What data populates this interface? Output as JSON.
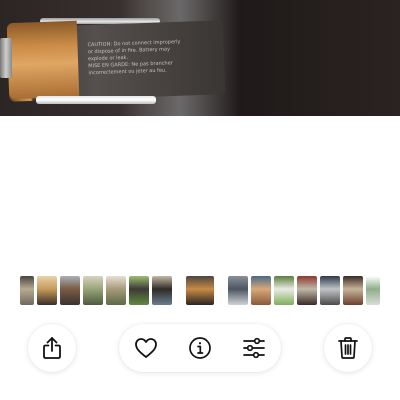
{
  "photo": {
    "subject": "battery-photo",
    "label_text_line1": "CAUTION: Do not connect improperly",
    "label_text_line2": "or dispose of in fire. Battery may",
    "label_text_line3": "explode or leak.",
    "label_text_line4": "MISE EN GARDE: Ne pas brancher",
    "label_text_line5": "incorrectement ou jeter au feu."
  },
  "thumbnails": [
    {
      "name": "thumb-1",
      "colors": [
        "#6f6a5f",
        "#b8aa90",
        "#4a4540"
      ]
    },
    {
      "name": "thumb-2",
      "colors": [
        "#3a2f27",
        "#c79a5a",
        "#e7d2a8"
      ]
    },
    {
      "name": "thumb-3",
      "colors": [
        "#3b3330",
        "#7a5a45",
        "#a8b0b8"
      ]
    },
    {
      "name": "thumb-4",
      "colors": [
        "#4d5a3c",
        "#9aa47a",
        "#d7d2c0"
      ]
    },
    {
      "name": "thumb-5",
      "colors": [
        "#5c6b45",
        "#a89a78",
        "#e5e0d4"
      ]
    },
    {
      "name": "thumb-6",
      "colors": [
        "#5f8a3e",
        "#3d3a35",
        "#9bbf72"
      ]
    },
    {
      "name": "thumb-7",
      "colors": [
        "#6a7d8f",
        "#2f2b28",
        "#c4b8a4"
      ]
    },
    {
      "name": "thumb-current",
      "colors": [
        "#2b2523",
        "#c98a45",
        "#4a4543"
      ]
    },
    {
      "name": "thumb-9",
      "colors": [
        "#cfd3d6",
        "#4c5660",
        "#8a9099"
      ]
    },
    {
      "name": "thumb-10",
      "colors": [
        "#8a5a3a",
        "#d7a878",
        "#4a6a8a"
      ]
    },
    {
      "name": "thumb-11",
      "colors": [
        "#7fae5a",
        "#e9ebe4",
        "#5b7d3c"
      ]
    },
    {
      "name": "thumb-12",
      "colors": [
        "#3a2a26",
        "#c0b7a8",
        "#8d3a2e"
      ]
    },
    {
      "name": "thumb-13",
      "colors": [
        "#4d4a47",
        "#bfc4c8",
        "#2e3a4a"
      ]
    },
    {
      "name": "thumb-14",
      "colors": [
        "#6b3f2f",
        "#c8b49a",
        "#3a2a24"
      ]
    },
    {
      "name": "thumb-15",
      "colors": [
        "#d8dcd8",
        "#8fae8a",
        "#ffffff"
      ]
    }
  ],
  "toolbar": {
    "share_icon": "share-icon",
    "favorite_icon": "heart-icon",
    "info_icon": "info-icon",
    "adjust_icon": "sliders-icon",
    "delete_icon": "trash-icon"
  },
  "colors": {
    "icon": "#111111",
    "button_bg": "#ffffff"
  }
}
